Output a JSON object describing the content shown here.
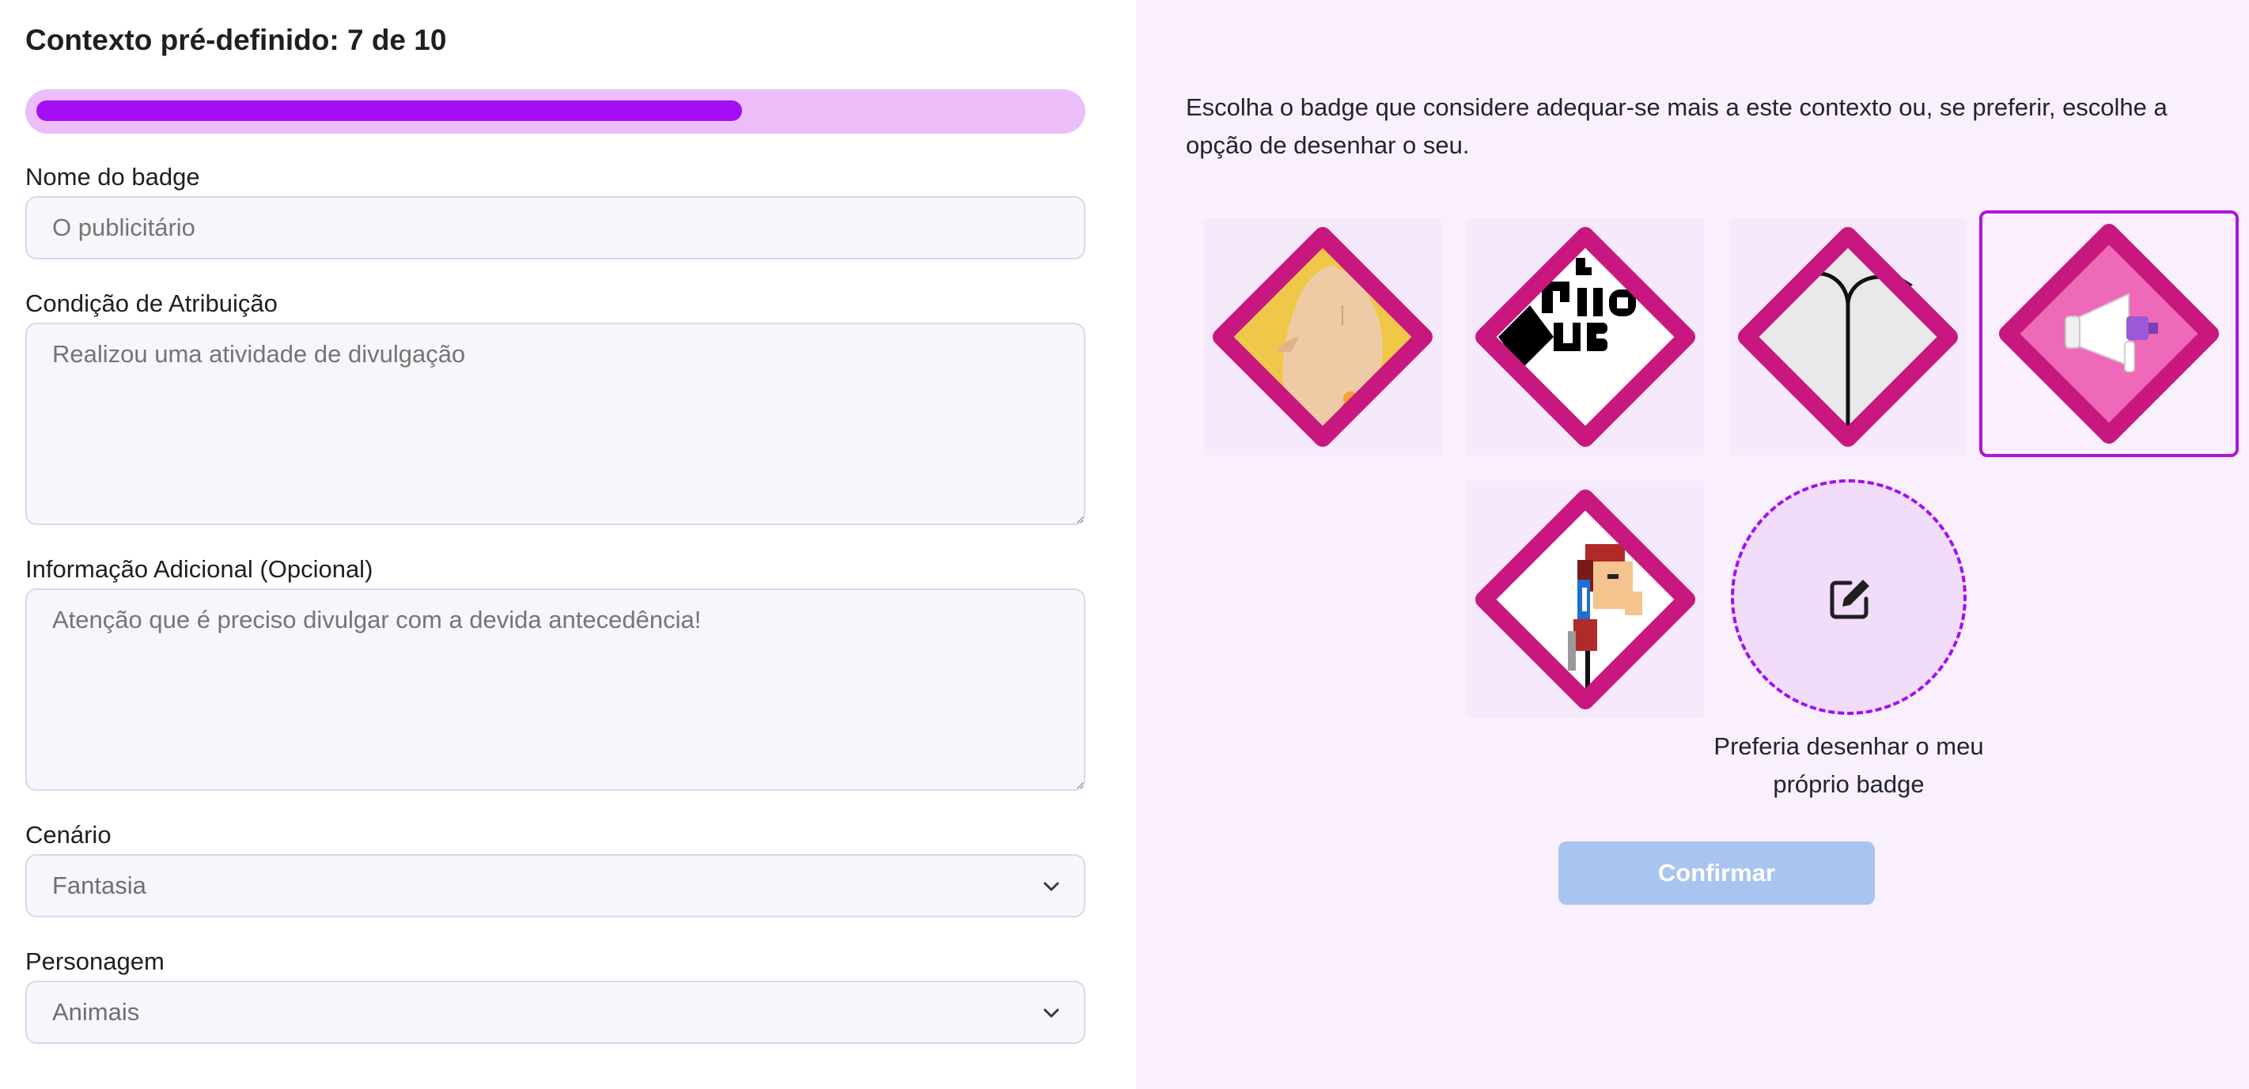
{
  "header": {
    "title": "Contexto pré-definido: 7 de 10"
  },
  "progress": {
    "current": 7,
    "total": 10,
    "fraction": 0.68
  },
  "form": {
    "badge_name": {
      "label": "Nome do badge",
      "placeholder": "O publicitário"
    },
    "condition": {
      "label": "Condição de Atribuição",
      "placeholder": "Realizou uma atividade de divulgação"
    },
    "extra_info": {
      "label": "Informação Adicional (Opcional)",
      "placeholder": "Atenção que é preciso divulgar com a devida antecedência!"
    },
    "scenario": {
      "label": "Cenário",
      "selected": "Fantasia"
    },
    "character": {
      "label": "Personagem",
      "selected": "Animais"
    }
  },
  "panel": {
    "instructions": "Escolha o badge que considere adequar-se mais a este contexto ou, se preferir, escolhe a opção de desenhar o seu.",
    "badges": [
      {
        "icon": "hand-badge-icon",
        "selected": false
      },
      {
        "icon": "text-collage-badge-icon",
        "selected": false
      },
      {
        "icon": "lamp-post-badge-icon",
        "selected": false
      },
      {
        "icon": "megaphone-badge-icon",
        "selected": true
      },
      {
        "icon": "pixel-character-badge-icon",
        "selected": false
      }
    ],
    "draw_option": {
      "icon": "edit-icon",
      "label": "Preferia desenhar o meu próprio badge"
    },
    "confirm_label": "Confirmar"
  },
  "colors": {
    "accent": "#a30ef2",
    "badge_border": "#c8177e",
    "panel_bg": "#faf0fd",
    "confirm_disabled": "#a9c4ee"
  }
}
